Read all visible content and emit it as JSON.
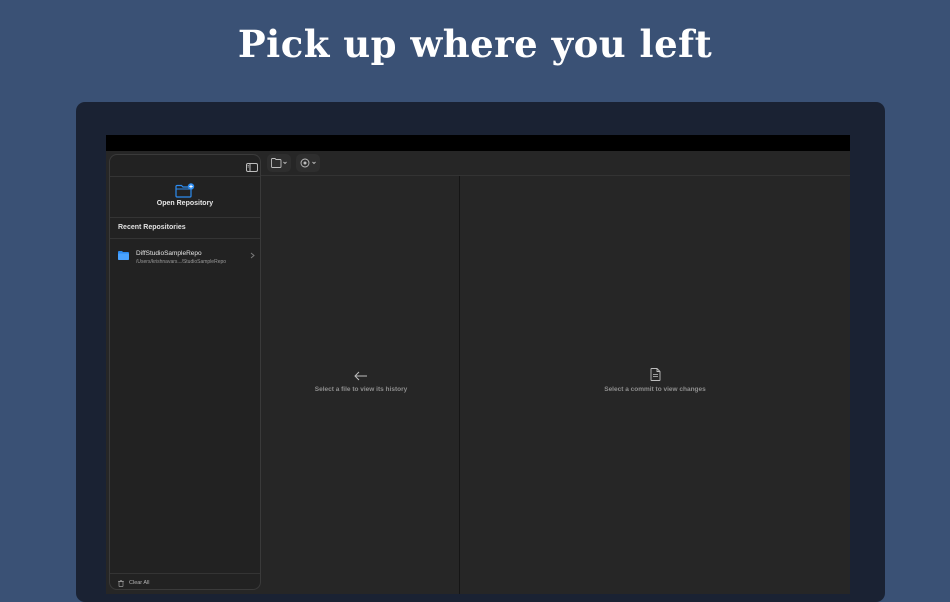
{
  "headline": "Pick up where you left",
  "sidebar": {
    "open_repository_label": "Open Repository",
    "recent_title": "Recent Repositories",
    "recent_items": [
      {
        "name": "DiffStudioSampleRepo",
        "path": "/Users/krishnavars.../StudioSampleRepo"
      }
    ],
    "clear_all_label": "Clear All"
  },
  "file_pane": {
    "empty_message": "Select a file to view its history"
  },
  "diff_pane": {
    "empty_message": "Select a commit to view changes"
  },
  "colors": {
    "page_background": "#3a5175",
    "accent": "#2d8cf0"
  }
}
